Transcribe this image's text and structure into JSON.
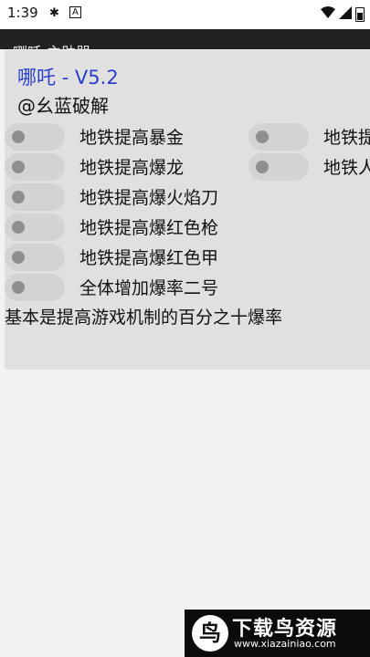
{
  "status_bar": {
    "time": "1:39",
    "icons": [
      "debug-icon",
      "a-icon",
      "wifi-icon",
      "signal-icon",
      "battery-icon"
    ]
  },
  "app_bar": {
    "title": "哪吒 主助器"
  },
  "card": {
    "title": "哪吒 - V5.2",
    "subtitle": "@幺蓝破解",
    "toggles": [
      {
        "label": "地铁提高暴金",
        "on": false
      },
      {
        "label": "地铁提高爆龙",
        "on": false
      },
      {
        "label": "地铁提高爆火焰刀",
        "on": false
      },
      {
        "label": "地铁提高爆红色枪",
        "on": false
      },
      {
        "label": "地铁提高爆红色甲",
        "on": false
      },
      {
        "label": "全体增加爆率二号",
        "on": false
      },
      {
        "label": "地铁提",
        "on": false
      },
      {
        "label": "地铁人",
        "on": false
      }
    ],
    "footnote": "基本是提高游戏机制的百分之十爆率"
  },
  "watermark": {
    "logo_glyph": "鸟",
    "name": "下载鸟资源",
    "url": "www.xiazainiao.com"
  },
  "colors": {
    "title_blue": "#2b3fcf",
    "card_bg": "#e0e0e0",
    "page_bg": "#f2f2f2"
  }
}
